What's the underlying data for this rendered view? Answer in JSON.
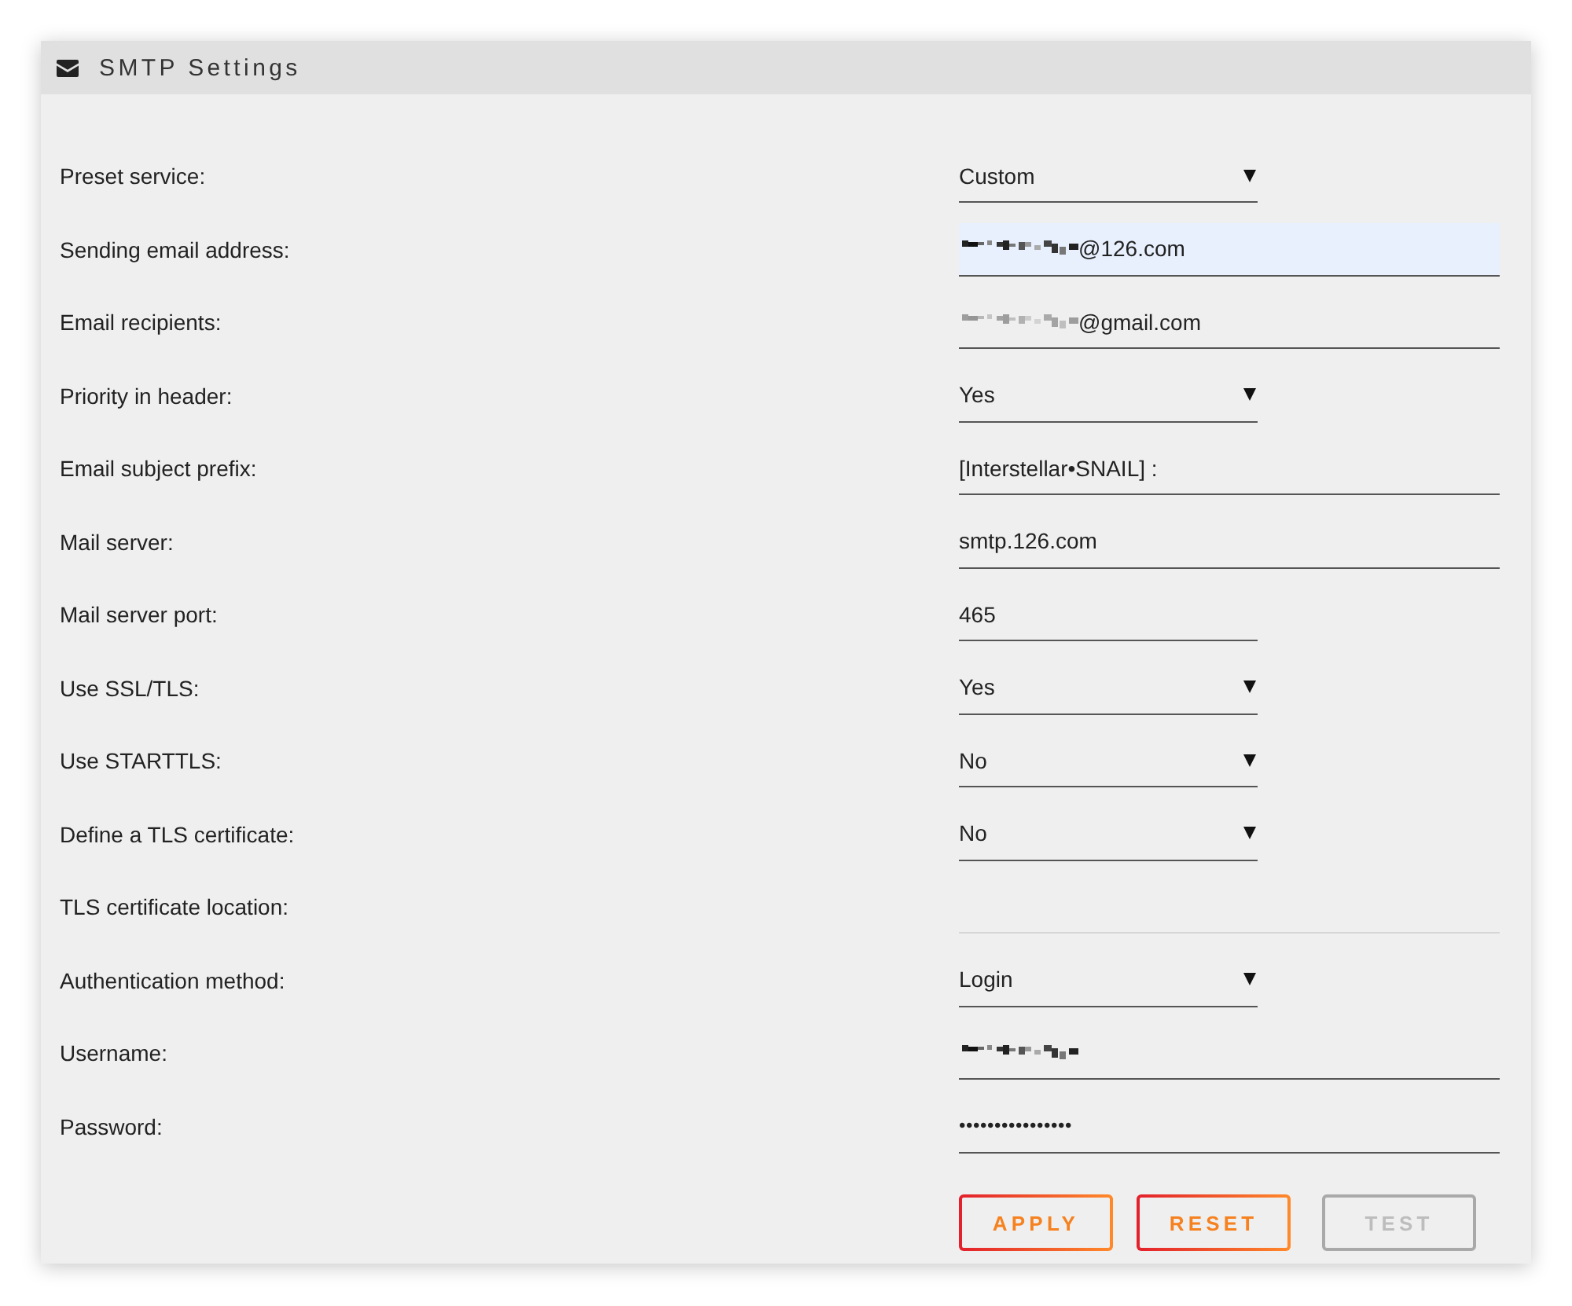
{
  "panel": {
    "title": "SMTP Settings",
    "rows": [
      {
        "label": "Preset service:",
        "kind": "select",
        "value": "Custom",
        "redacted": false,
        "autofilled": false,
        "disabled": false
      },
      {
        "label": "Sending email address:",
        "kind": "text",
        "value": "@126.com",
        "redacted": true,
        "autofilled": true,
        "disabled": false
      },
      {
        "label": "Email recipients:",
        "kind": "text",
        "value": "@gmail.com",
        "redacted": true,
        "autofilled": false,
        "disabled": false
      },
      {
        "label": "Priority in header:",
        "kind": "select",
        "value": "Yes",
        "redacted": false,
        "autofilled": false,
        "disabled": false
      },
      {
        "label": "Email subject prefix:",
        "kind": "text",
        "value": "[Interstellar•SNAIL] :",
        "redacted": false,
        "autofilled": false,
        "disabled": false
      },
      {
        "label": "Mail server:",
        "kind": "text",
        "value": "smtp.126.com",
        "redacted": false,
        "autofilled": false,
        "disabled": false
      },
      {
        "label": "Mail server port:",
        "kind": "number",
        "value": "465",
        "redacted": false,
        "autofilled": false,
        "disabled": false
      },
      {
        "label": "Use SSL/TLS:",
        "kind": "select",
        "value": "Yes",
        "redacted": false,
        "autofilled": false,
        "disabled": false
      },
      {
        "label": "Use STARTTLS:",
        "kind": "select",
        "value": "No",
        "redacted": false,
        "autofilled": false,
        "disabled": false
      },
      {
        "label": "Define a TLS certificate:",
        "kind": "select",
        "value": "No",
        "redacted": false,
        "autofilled": false,
        "disabled": false
      },
      {
        "label": "TLS certificate location:",
        "kind": "text",
        "redacted": false,
        "autofilled": false,
        "disabled": true
      },
      {
        "label": "Authentication method:",
        "kind": "select",
        "value": "Login",
        "redacted": false,
        "autofilled": false,
        "disabled": false
      },
      {
        "label": "Username:",
        "kind": "text",
        "redacted": true,
        "autofilled": false,
        "disabled": false
      },
      {
        "label": "Password:",
        "kind": "password",
        "value": "••••••••••••••••",
        "redacted": false,
        "autofilled": false,
        "disabled": false
      }
    ],
    "buttons": [
      {
        "label": "APPLY",
        "disabled": false
      },
      {
        "label": "RESET",
        "disabled": false
      },
      {
        "label": "TEST",
        "disabled": true
      }
    ]
  }
}
